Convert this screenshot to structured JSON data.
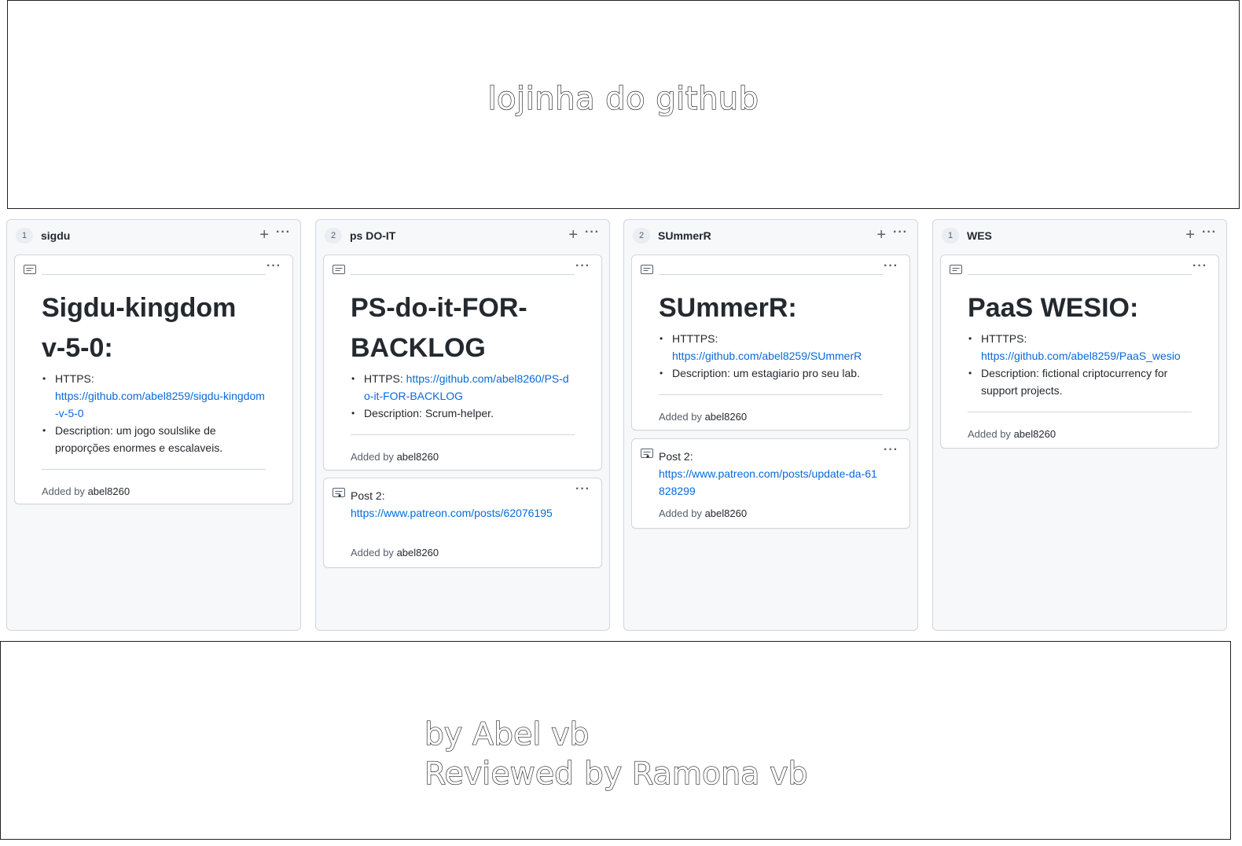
{
  "header": {
    "title": "lojinha do github"
  },
  "footer": {
    "line1": "by Abel vb",
    "line2": "Reviewed by Ramona vb"
  },
  "columns": [
    {
      "count": "1",
      "name": "sigdu",
      "cards": [
        {
          "title": "Sigdu-kingdom v-5-0:",
          "https_label": "HTTPS:",
          "https_url": "https://github.com/abel8259/sigdu-kingdom-v-5-0",
          "desc_label": "Description:",
          "desc_text": "um jogo soulslike de proporções enormes e escalaveis.",
          "added_prefix": "Added by",
          "added_user": "abel8260"
        }
      ]
    },
    {
      "count": "2",
      "name": "ps DO-IT",
      "cards": [
        {
          "title": "PS-do-it-FOR-BACKLOG",
          "https_label": "HTTPS:",
          "https_url": "https://github.com/abel8260/PS-do-it-FOR-BACKLOG",
          "desc_label": "Description:",
          "desc_text": "Scrum-helper.",
          "added_prefix": "Added by",
          "added_user": "abel8260"
        },
        {
          "post_label": "Post 2:",
          "post_url": "https://www.patreon.com/posts/62076195",
          "added_prefix": "Added by",
          "added_user": "abel8260"
        }
      ]
    },
    {
      "count": "2",
      "name": "SUmmerR",
      "cards": [
        {
          "title": "SUmmerR:",
          "https_label": "HTTTPS:",
          "https_url": "https://github.com/abel8259/SUmmerR",
          "desc_label": "Description:",
          "desc_text": "um estagiario pro seu lab.",
          "added_prefix": "Added by",
          "added_user": "abel8260"
        },
        {
          "post_label": "Post 2:",
          "post_url": "https://www.patreon.com/posts/update-da-61828299",
          "added_prefix": "Added by",
          "added_user": "abel8260"
        }
      ]
    },
    {
      "count": "1",
      "name": "WES",
      "cards": [
        {
          "title": "PaaS WESIO:",
          "https_label": "HTTTPS:",
          "https_url": "https://github.com/abel8259/PaaS_wesio",
          "desc_label": "Description:",
          "desc_text": "fictional criptocurrency for support projects.",
          "added_prefix": "Added by",
          "added_user": "abel8260"
        }
      ]
    }
  ],
  "icons": {
    "note": "note-icon",
    "plus": "plus-icon",
    "more": "kebab-horizontal-icon"
  },
  "colors": {
    "link": "#0969da",
    "column_bg": "#f6f8fa",
    "border": "#d0d7de"
  }
}
